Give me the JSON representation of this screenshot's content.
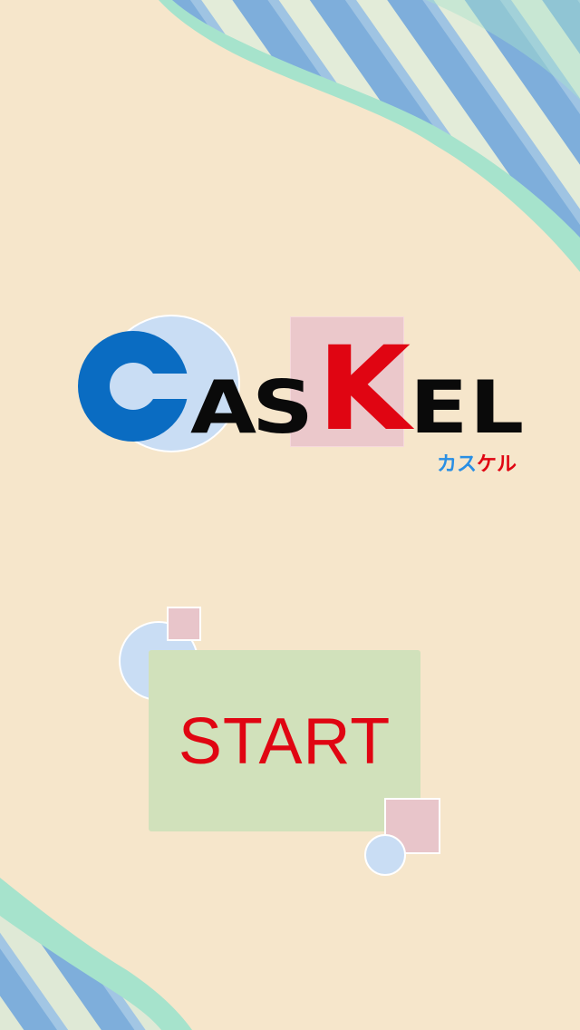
{
  "app": {
    "logo_text": {
      "letter_a": "A",
      "letter_s": "S",
      "letter_k": "K",
      "letter_e": "E",
      "letter_l": "L"
    },
    "subtitle": {
      "part_blue": "カス",
      "part_red": "ケル"
    },
    "start_label": "START"
  },
  "colors": {
    "background": "#f6e6cb",
    "brand_blue": "#0a6cc2",
    "brand_red": "#e00512",
    "logo_black": "#0a0a0a",
    "subtitle_blue": "#2a8fe4",
    "light_blue": "#c9ddf4",
    "light_pink": "#ebc8cb",
    "button_green": "#d1e1bb",
    "stripe_blue": "#7eaedb",
    "stripe_mint": "#a6e3cc"
  },
  "icons": {
    "logo_c": "c-letter-ring-icon",
    "decor": "diagonal-stripe-ribbon"
  }
}
